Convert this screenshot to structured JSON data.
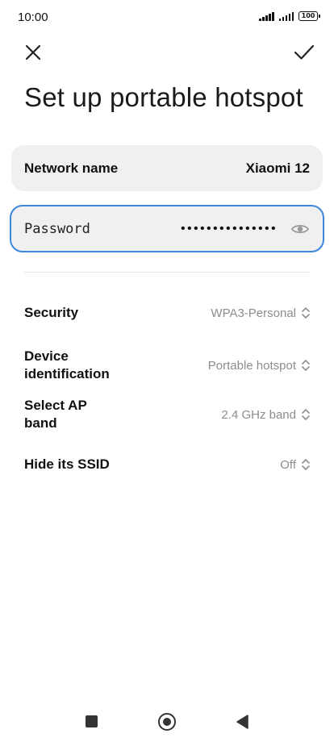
{
  "status_bar": {
    "time": "10:00",
    "battery": "100"
  },
  "header": {
    "title": "Set up portable hotspot",
    "close_icon": "close-icon",
    "confirm_icon": "checkmark-icon"
  },
  "network_name": {
    "label": "Network name",
    "value": "Xiaomi 12"
  },
  "password": {
    "label": "Password",
    "value": "•••••••••••••••",
    "toggle_icon": "eye-icon"
  },
  "settings": [
    {
      "label": "Security",
      "value": "WPA3-Personal"
    },
    {
      "label": "Device\nidentification",
      "value": "Portable hotspot"
    },
    {
      "label": "Select AP\nband",
      "value": "2.4 GHz band"
    },
    {
      "label": "Hide its SSID",
      "value": "Off"
    }
  ],
  "colors": {
    "accent": "#3b88e0",
    "card_bg": "#f0f0f0",
    "secondary_text": "#8d8d8d"
  }
}
